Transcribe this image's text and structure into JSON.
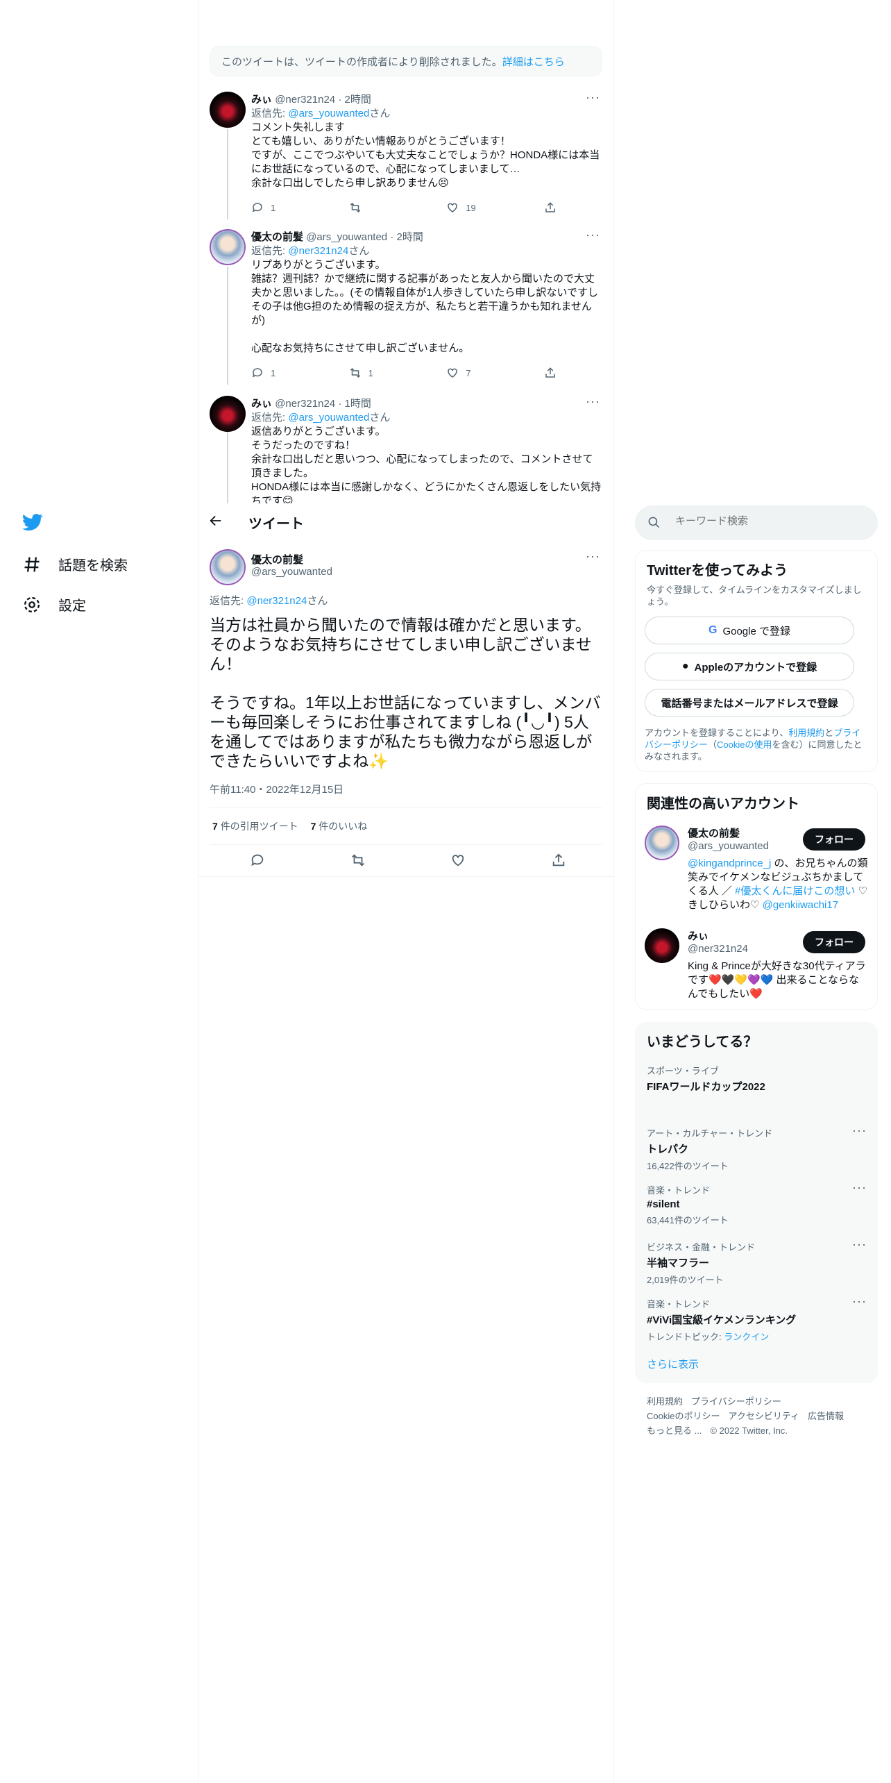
{
  "deleted_notice": {
    "text": "このツイートは、ツイートの作成者により削除されました。",
    "link": "詳細はこちら"
  },
  "tweets": [
    {
      "name": "みぃ",
      "handle": "@ner321n24",
      "time": "2時間",
      "reply_prefix": "返信先: ",
      "reply_to": "@ars_youwanted",
      "reply_suffix": "さん",
      "body": "コメント失礼します\nとても嬉しい、ありがたい情報ありがとうございます！\nですが、ここでつぶやいても大丈夫なことでしょうか？HONDA様には本当にお世話になっているので、心配になってしまいまして…\n余計な口出しでしたら申し訳ありません😣",
      "replies": "1",
      "retweets": "",
      "likes": "19"
    },
    {
      "name": "優太の前髪",
      "handle": "@ars_youwanted",
      "time": "2時間",
      "reply_prefix": "返信先: ",
      "reply_to": "@ner321n24",
      "reply_suffix": "さん",
      "body": "リプありがとうございます。\n雑誌？週刊誌？かで継続に関する記事があったと友人から聞いたので大丈夫かと思いました。。(その情報自体が1人歩きしていたら申し訳ないですしその子は他G担のため情報の捉え方が、私たちと若干違うかも知れませんが)\n\n心配なお気持ちにさせて申し訳ございません。",
      "replies": "1",
      "retweets": "1",
      "likes": "7"
    },
    {
      "name": "みぃ",
      "handle": "@ner321n24",
      "time": "1時間",
      "reply_prefix": "返信先: ",
      "reply_to": "@ars_youwanted",
      "reply_suffix": "さん",
      "body": "返信ありがとうございます。\nそうだったのですね！\n余計な口出しだと思いつつ、心配になってしまったので、コメントさせて頂きました。\nHONDA様には本当に感謝しかなく、どうにかたくさん恩返しをしたい気持ちです😊"
    }
  ],
  "topbar": {
    "title": "ツイート"
  },
  "main_tweet": {
    "name": "優太の前髪",
    "handle": "@ars_youwanted",
    "reply_prefix": "返信先: ",
    "reply_to": "@ner321n24",
    "reply_suffix": "さん",
    "body": "当方は社員から聞いたので情報は確かだと思います。そのようなお気持ちにさせてしまい申し訳ございません！\n\nそうですね。1年以上お世話になっていますし、メンバーも毎回楽しそうにお仕事されてますしね (╹◡╹) 5人を通してではありますが私たちも微力ながら恩返しができたらいいですよね✨",
    "timestamp": "午前11:40・2022年12月15日",
    "quote_count": "7",
    "quote_label": "件の引用ツイート",
    "like_count": "7",
    "like_label": "件のいいね"
  },
  "left_nav": {
    "explore": "話題を検索",
    "settings": "設定"
  },
  "search": {
    "placeholder": "キーワード検索"
  },
  "signup": {
    "title": "Twitterを使ってみよう",
    "subtitle": "今すぐ登録して、タイムラインをカスタマイズしましょう。",
    "google": "Google で登録",
    "apple": "Appleのアカウントで登録",
    "phone": "電話番号またはメールアドレスで登録",
    "legal_1": "アカウントを登録することにより、",
    "legal_terms": "利用規約",
    "legal_and": "と",
    "legal_privacy": "プライバシーポリシー",
    "legal_2": "（",
    "legal_cookie": "Cookieの使用",
    "legal_3": "を含む）に同意したとみなされます。"
  },
  "related": {
    "title": "関連性の高いアカウント",
    "follow": "フォロー",
    "accounts": [
      {
        "name": "優太の前髪",
        "handle": "@ars_youwanted",
        "bio_link1": "@kingandprince_j",
        "bio_1": " の、お兄ちゃんの類笑みでイケメンなビジュぶちかましてくる人 ／ ",
        "bio_link2": "#優太くんに届けこの想い",
        "bio_2": " ♡きしひらいわ♡ ",
        "bio_link3": "@genkiiwachi17"
      },
      {
        "name": "みぃ",
        "handle": "@ner321n24",
        "bio": "King & Princeが大好きな30代ティアラです❤️🖤💛💜💙 出来ることならなんでもしたい❤️"
      }
    ]
  },
  "trends": {
    "title": "いまどうしてる？",
    "items": [
      {
        "category": "スポーツ・ライブ",
        "title": "FIFAワールドカップ2022",
        "count": ""
      },
      {
        "category": "アート・カルチャー・トレンド",
        "title": "トレパク",
        "count": "16,422件のツイート"
      },
      {
        "category": "音楽・トレンド",
        "title": "#silent",
        "count": "63,441件のツイート"
      },
      {
        "category": "ビジネス・金融・トレンド",
        "title": "半袖マフラー",
        "count": "2,019件のツイート"
      },
      {
        "category": "音楽・トレンド",
        "title": "#ViVi国宝級イケメンランキング",
        "count_prefix": "トレンドトピック: ",
        "count_link": "ランクイン"
      }
    ],
    "show_more": "さらに表示"
  },
  "footer": {
    "terms": "利用規約",
    "privacy": "プライバシーポリシー",
    "cookie": "Cookieのポリシー",
    "accessibility": "アクセシビリティ",
    "ads": "広告情報",
    "more": "もっと見る ...",
    "copyright": "© 2022 Twitter, Inc."
  },
  "colors": {
    "accent": "#1d9bf0",
    "text": "#0f1419",
    "muted": "#536471"
  }
}
